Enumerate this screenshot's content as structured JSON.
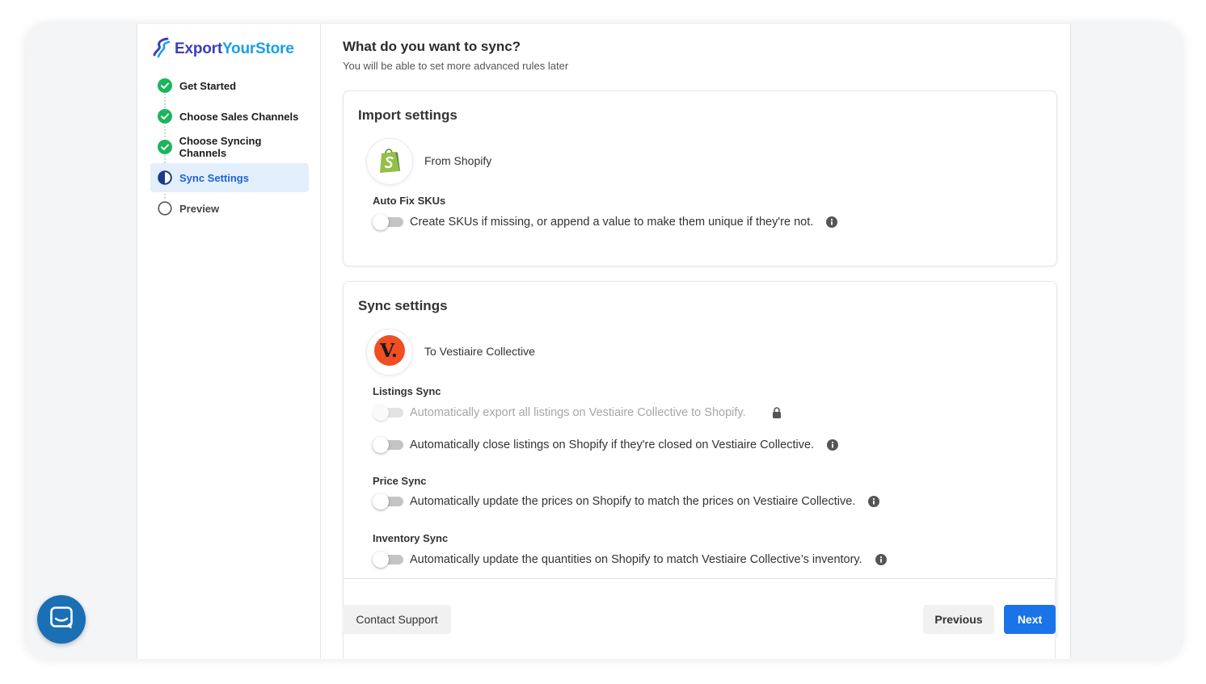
{
  "brand": {
    "part1": "Export",
    "part2": "YourStore",
    "accent": "#1aa0e6",
    "secondary": "#3b3fb8"
  },
  "steps": [
    {
      "label": "Get Started",
      "status": "complete",
      "icon": "check-circle-icon"
    },
    {
      "label": "Choose Sales Channels",
      "status": "complete",
      "icon": "check-circle-icon"
    },
    {
      "label": "Choose Syncing Channels",
      "status": "complete",
      "icon": "check-circle-icon"
    },
    {
      "label": "Sync Settings",
      "status": "active",
      "icon": "half-circle-icon"
    },
    {
      "label": "Preview",
      "status": "pending",
      "icon": "empty-circle-icon"
    }
  ],
  "main": {
    "title": "What do you want to sync?",
    "subtitle": "You will be able to set more advanced rules later"
  },
  "import_settings": {
    "title": "Import settings",
    "channel": "From Shopify",
    "channel_icon": "shopify-bag-icon",
    "auto_fix_label": "Auto Fix SKUs",
    "auto_fix_toggle": "Create SKUs if missing, or append a value to make them unique if they're not.",
    "auto_fix_enabled": false
  },
  "sync_settings": {
    "title": "Sync settings",
    "channel": "To Vestiaire Collective",
    "channel_icon": "vestiaire-v-icon",
    "listings_label": "Listings Sync",
    "listings_export": "Automatically export all listings on Vestiaire Collective to Shopify.",
    "listings_export_locked": true,
    "listings_close": "Automatically close listings on Shopify if they're closed on Vestiaire Collective.",
    "price_label": "Price Sync",
    "price_toggle": "Automatically update the prices on Shopify to match the prices on Vestiaire Collective.",
    "inventory_label": "Inventory Sync",
    "inventory_toggle": "Automatically update the quantities on Shopify to match Vestiaire Collective’s inventory."
  },
  "footer": {
    "contact_support": "Contact Support",
    "previous": "Previous",
    "next": "Next",
    "next_color": "#1a73e8"
  },
  "chat_widget": {
    "icon": "chat-bubble-icon",
    "color": "#1b6fb5"
  }
}
